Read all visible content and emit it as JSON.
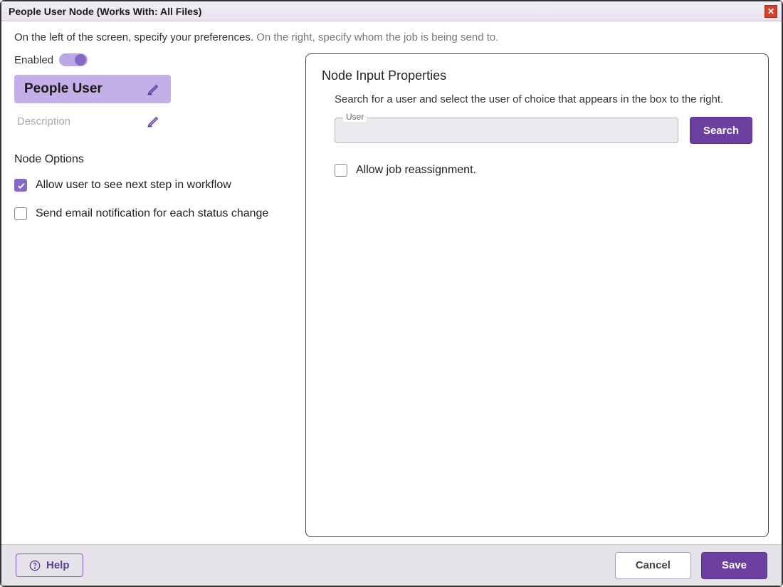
{
  "window": {
    "title": "People User Node (Works With: All Files)"
  },
  "instruction": {
    "left": "On the left of the screen, specify your preferences. ",
    "right": "On the right, specify whom the job is being send to."
  },
  "left": {
    "enabled_label": "Enabled",
    "enabled": true,
    "name": "People User",
    "description_placeholder": "Description",
    "section": "Node Options",
    "option_allow_next": {
      "label": "Allow user to see next step in workflow",
      "checked": true
    },
    "option_email_notify": {
      "label": "Send email notification for each status change",
      "checked": false
    }
  },
  "right": {
    "panel_title": "Node Input Properties",
    "panel_desc": "Search for a user and select the user of choice that appears in the box to the right.",
    "user_label": "User",
    "user_value": "",
    "search_label": "Search",
    "reassign": {
      "label": "Allow job reassignment.",
      "checked": false
    }
  },
  "footer": {
    "help": "Help",
    "cancel": "Cancel",
    "save": "Save"
  }
}
